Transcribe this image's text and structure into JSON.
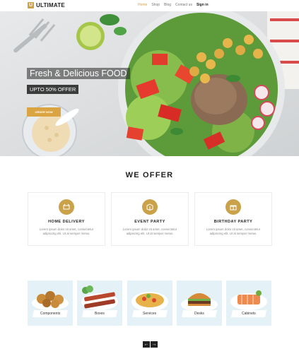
{
  "header": {
    "logo_mark": "U",
    "logo_text": "ULTIMATE",
    "nav": [
      {
        "label": "Home",
        "active": true
      },
      {
        "label": "Shop",
        "active": false
      },
      {
        "label": "Blog",
        "active": false
      },
      {
        "label": "Contact us",
        "active": false
      },
      {
        "label": "Sign in",
        "active": false
      }
    ]
  },
  "hero": {
    "title": "Fresh & Delicious FOOD",
    "offer": "UPTO 50% OFFER",
    "button": "ORDER NOW"
  },
  "offer_section": {
    "title": "WE OFFER",
    "cards": [
      {
        "icon": "delivery-icon",
        "title": "HOME DELIVERY",
        "text": "Lorem ipsum dolor sit amet, consectetur adipiscing elit. Ut at semper metus."
      },
      {
        "icon": "party-box-icon",
        "title": "EVENT PARTY",
        "text": "Lorem ipsum dolor sit amet, consectetur adipiscing elit. Ut at semper metus."
      },
      {
        "icon": "gift-icon",
        "title": "BIRTHDAY PARTY",
        "text": "Lorem ipsum dolor sit amet, consectetur adipiscing elit. Ut at semper metus."
      }
    ]
  },
  "categories": [
    {
      "label": "Components"
    },
    {
      "label": "Boxes"
    },
    {
      "label": "Services"
    },
    {
      "label": "Desks"
    },
    {
      "label": "Cabinets"
    }
  ],
  "pager": {
    "prev": "←",
    "next": "→"
  },
  "colors": {
    "accent": "#d9a441",
    "icon_bg": "#c9a24a",
    "tile_bg": "#e4f1f6"
  }
}
